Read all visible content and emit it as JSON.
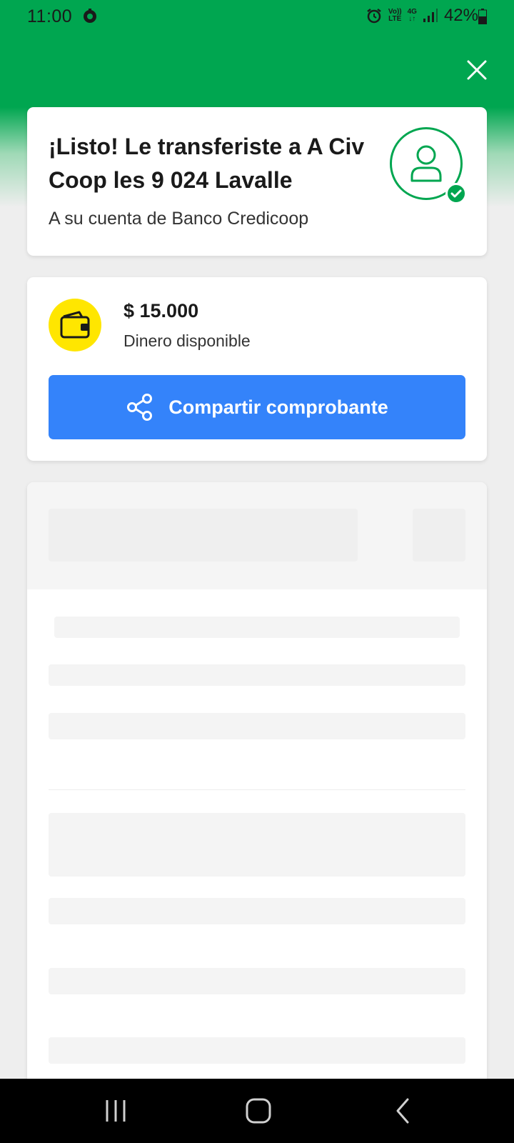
{
  "status_bar": {
    "time": "11:00",
    "volte_top": "Vo))",
    "volte_bottom": "LTE",
    "network_top": "4G",
    "network_bottom": "↓↑",
    "battery": "42%"
  },
  "success_card": {
    "title": "¡Listo! Le transferiste a A Civ Coop les 9 024 Lavalle",
    "subtitle": "A su cuenta de Banco Credicoop"
  },
  "balance_card": {
    "amount": "$ 15.000",
    "label": "Dinero disponible",
    "share_button_label": "Compartir comprobante"
  },
  "colors": {
    "brand_green": "#00a650",
    "button_blue": "#3483fa",
    "wallet_yellow": "#ffe600"
  }
}
